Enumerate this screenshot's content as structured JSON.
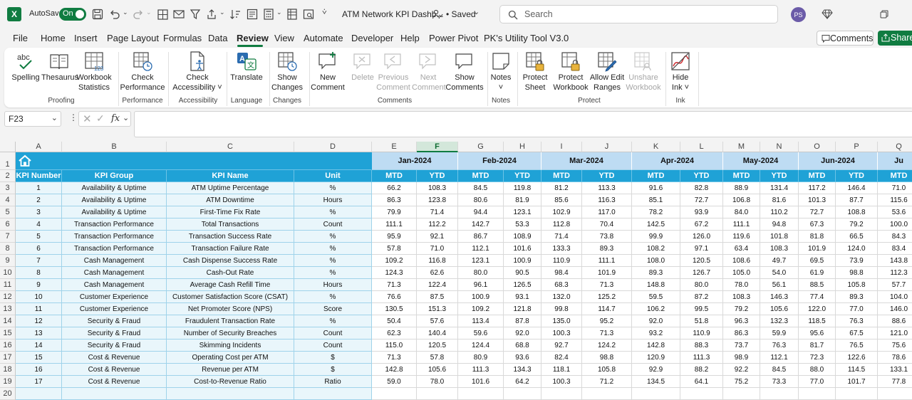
{
  "title_bar": {
    "autosave_label": "AutoSave",
    "autosave_state": "On",
    "file_name": "ATM Network KPI Dashb...",
    "save_status": "• Saved",
    "search_placeholder": "Search",
    "user_initials": "PS",
    "brand_color": "#107c41"
  },
  "menu": {
    "tabs": [
      "File",
      "Home",
      "Insert",
      "Page Layout",
      "Formulas",
      "Data",
      "Review",
      "View",
      "Automate",
      "Developer",
      "Help",
      "Power Pivot",
      "PK's Utility Tool V3.0"
    ],
    "active_tab": "Review",
    "comments_button": "Comments",
    "share_button": "Share"
  },
  "ribbon": {
    "groups": [
      {
        "label": "Proofing",
        "buttons": [
          {
            "label": "Spelling",
            "icon": "spelling-icon"
          },
          {
            "label": "Thesaurus",
            "icon": "thesaurus-icon"
          },
          {
            "label": "Workbook\nStatistics",
            "icon": "workbook-statistics-icon"
          }
        ]
      },
      {
        "label": "Performance",
        "buttons": [
          {
            "label": "Check\nPerformance",
            "icon": "check-performance-icon"
          }
        ]
      },
      {
        "label": "Accessibility",
        "buttons": [
          {
            "label": "Check\nAccessibility ˅",
            "icon": "check-accessibility-icon"
          }
        ]
      },
      {
        "label": "Language",
        "buttons": [
          {
            "label": "Translate",
            "icon": "translate-icon"
          }
        ]
      },
      {
        "label": "Changes",
        "buttons": [
          {
            "label": "Show\nChanges",
            "icon": "show-changes-icon"
          }
        ]
      },
      {
        "label": "Comments",
        "buttons": [
          {
            "label": "New\nComment",
            "icon": "new-comment-icon",
            "disabled": false
          },
          {
            "label": "Delete",
            "icon": "delete-comment-icon",
            "disabled": true
          },
          {
            "label": "Previous\nComment",
            "icon": "previous-comment-icon",
            "disabled": true
          },
          {
            "label": "Next\nComment",
            "icon": "next-comment-icon",
            "disabled": true
          },
          {
            "label": "Show\nComments",
            "icon": "show-comments-icon",
            "disabled": false
          }
        ]
      },
      {
        "label": "Notes",
        "buttons": [
          {
            "label": "Notes\n˅",
            "icon": "notes-icon"
          }
        ]
      },
      {
        "label": "Protect",
        "buttons": [
          {
            "label": "Protect\nSheet",
            "icon": "protect-sheet-icon",
            "disabled": false
          },
          {
            "label": "Protect\nWorkbook",
            "icon": "protect-workbook-icon",
            "disabled": false
          },
          {
            "label": "Allow Edit\nRanges",
            "icon": "allow-edit-ranges-icon",
            "disabled": false
          },
          {
            "label": "Unshare\nWorkbook",
            "icon": "unshare-workbook-icon",
            "disabled": true
          }
        ]
      },
      {
        "label": "Ink",
        "buttons": [
          {
            "label": "Hide\nInk ˅",
            "icon": "hide-ink-icon"
          }
        ]
      }
    ]
  },
  "formula_bar": {
    "name_box": "F23",
    "fx_label": "fx",
    "formula_value": ""
  },
  "sheet": {
    "column_letters": [
      "A",
      "B",
      "C",
      "D",
      "E",
      "F",
      "G",
      "H",
      "I",
      "J",
      "K",
      "L",
      "M",
      "N",
      "O",
      "P",
      "Q"
    ],
    "selected_column": "F",
    "row_numbers": [
      "1",
      "2",
      "3",
      "4",
      "5",
      "6",
      "7",
      "8",
      "9",
      "10",
      "11",
      "12",
      "13",
      "14",
      "15",
      "16",
      "17",
      "18",
      "19",
      "20"
    ],
    "headers": [
      "KPI Number",
      "KPI Group",
      "KPI Name",
      "Unit"
    ],
    "months": [
      "Jan-2024",
      "Feb-2024",
      "Mar-2024",
      "Apr-2024",
      "May-2024",
      "Jun-2024",
      "Ju"
    ],
    "mtd_label": "MTD",
    "ytd_label": "YTD",
    "header_color": "#1fa2d6",
    "month_band_color": "#bedcf3",
    "rows": [
      [
        "1",
        "Availability & Uptime",
        "ATM Uptime Percentage",
        "%",
        "66.2",
        "108.3",
        "84.5",
        "119.8",
        "81.2",
        "113.3",
        "91.6",
        "82.8",
        "88.9",
        "131.4",
        "117.2",
        "146.4",
        "71.0"
      ],
      [
        "2",
        "Availability & Uptime",
        "ATM Downtime",
        "Hours",
        "86.3",
        "123.8",
        "80.6",
        "81.9",
        "85.6",
        "116.3",
        "85.1",
        "72.7",
        "106.8",
        "81.6",
        "101.3",
        "87.7",
        "115.6"
      ],
      [
        "3",
        "Availability & Uptime",
        "First-Time Fix Rate",
        "%",
        "79.9",
        "71.4",
        "94.4",
        "123.1",
        "102.9",
        "117.0",
        "78.2",
        "93.9",
        "84.0",
        "110.2",
        "72.7",
        "108.8",
        "53.6"
      ],
      [
        "4",
        "Transaction Performance",
        "Total Transactions",
        "Count",
        "111.1",
        "112.2",
        "142.7",
        "53.3",
        "112.8",
        "70.4",
        "142.5",
        "67.2",
        "111.1",
        "94.8",
        "67.3",
        "79.2",
        "100.0"
      ],
      [
        "5",
        "Transaction Performance",
        "Transaction Success Rate",
        "%",
        "95.9",
        "92.1",
        "86.7",
        "108.9",
        "71.4",
        "73.8",
        "99.9",
        "126.0",
        "119.6",
        "101.8",
        "81.8",
        "66.5",
        "84.3"
      ],
      [
        "6",
        "Transaction Performance",
        "Transaction Failure Rate",
        "%",
        "57.8",
        "71.0",
        "112.1",
        "101.6",
        "133.3",
        "89.3",
        "108.2",
        "97.1",
        "63.4",
        "108.3",
        "101.9",
        "124.0",
        "83.4"
      ],
      [
        "7",
        "Cash Management",
        "Cash Dispense Success Rate",
        "%",
        "109.2",
        "116.8",
        "123.1",
        "100.9",
        "110.9",
        "111.1",
        "108.0",
        "120.5",
        "108.6",
        "49.7",
        "69.5",
        "73.9",
        "143.8"
      ],
      [
        "8",
        "Cash Management",
        "Cash-Out Rate",
        "%",
        "124.3",
        "62.6",
        "80.0",
        "90.5",
        "98.4",
        "101.9",
        "89.3",
        "126.7",
        "105.0",
        "54.0",
        "61.9",
        "98.8",
        "112.3"
      ],
      [
        "9",
        "Cash Management",
        "Average Cash Refill Time",
        "Hours",
        "71.3",
        "122.4",
        "96.1",
        "126.5",
        "68.3",
        "71.3",
        "148.8",
        "80.0",
        "78.0",
        "56.1",
        "88.5",
        "105.8",
        "57.7"
      ],
      [
        "10",
        "Customer Experience",
        "Customer Satisfaction Score (CSAT)",
        "%",
        "76.6",
        "87.5",
        "100.9",
        "93.1",
        "132.0",
        "125.2",
        "59.5",
        "87.2",
        "108.3",
        "146.3",
        "77.4",
        "89.3",
        "104.0"
      ],
      [
        "11",
        "Customer Experience",
        "Net Promoter Score (NPS)",
        "Score",
        "130.5",
        "151.3",
        "109.2",
        "121.8",
        "99.8",
        "114.7",
        "106.2",
        "99.5",
        "79.2",
        "105.6",
        "122.0",
        "77.0",
        "146.0"
      ],
      [
        "12",
        "Security & Fraud",
        "Fraudulent Transaction Rate",
        "%",
        "50.4",
        "57.6",
        "113.4",
        "87.8",
        "135.0",
        "95.2",
        "92.0",
        "51.8",
        "96.3",
        "132.3",
        "118.5",
        "76.3",
        "88.6"
      ],
      [
        "13",
        "Security & Fraud",
        "Number of Security Breaches",
        "Count",
        "62.3",
        "140.4",
        "59.6",
        "92.0",
        "100.3",
        "71.3",
        "93.2",
        "110.9",
        "86.3",
        "59.9",
        "95.6",
        "67.5",
        "121.0"
      ],
      [
        "14",
        "Security & Fraud",
        "Skimming Incidents",
        "Count",
        "115.0",
        "120.5",
        "124.4",
        "68.8",
        "92.7",
        "124.2",
        "142.8",
        "88.3",
        "73.7",
        "76.3",
        "81.7",
        "76.5",
        "75.6"
      ],
      [
        "15",
        "Cost & Revenue",
        "Operating Cost per ATM",
        "$",
        "71.3",
        "57.8",
        "80.9",
        "93.6",
        "82.4",
        "98.8",
        "120.9",
        "111.3",
        "98.9",
        "112.1",
        "72.3",
        "122.6",
        "78.6"
      ],
      [
        "16",
        "Cost & Revenue",
        "Revenue per ATM",
        "$",
        "142.8",
        "105.6",
        "111.3",
        "134.3",
        "118.1",
        "105.8",
        "92.9",
        "88.2",
        "92.2",
        "84.5",
        "88.0",
        "114.5",
        "133.1"
      ],
      [
        "17",
        "Cost & Revenue",
        "Cost-to-Revenue Ratio",
        "Ratio",
        "59.0",
        "78.0",
        "101.6",
        "64.2",
        "100.3",
        "71.2",
        "134.5",
        "64.1",
        "75.2",
        "73.3",
        "77.0",
        "101.7",
        "77.8"
      ]
    ]
  }
}
